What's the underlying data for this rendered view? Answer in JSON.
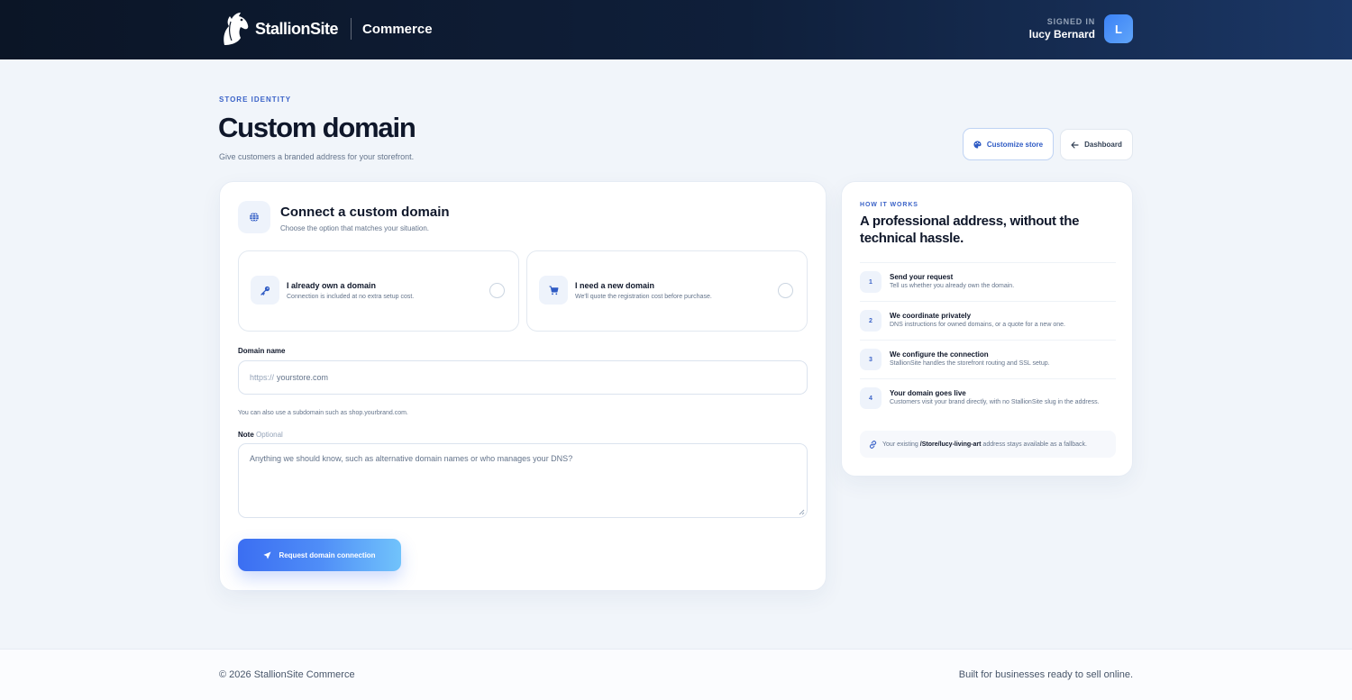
{
  "header": {
    "brand_name": "StallionSite",
    "product": "Commerce",
    "signed_in_label": "SIGNED IN",
    "user_name": "lucy Bernard",
    "avatar_initial": "L"
  },
  "page": {
    "eyebrow": "STORE IDENTITY",
    "title": "Custom domain",
    "subtitle": "Give customers a branded address for your storefront.",
    "customize_label": "Customize store",
    "dashboard_label": "Dashboard"
  },
  "form": {
    "title": "Connect a custom domain",
    "subtitle": "Choose the option that matches your situation.",
    "options": [
      {
        "title": "I already own a domain",
        "desc": "Connection is included at no extra setup cost.",
        "icon": "key-icon"
      },
      {
        "title": "I need a new domain",
        "desc": "We'll quote the registration cost before purchase.",
        "icon": "cart-icon"
      }
    ],
    "domain_label": "Domain name",
    "domain_prefix": "https://",
    "domain_placeholder": "yourstore.com",
    "domain_hint": "You can also use a subdomain such as shop.yourbrand.com.",
    "note_label": "Note",
    "note_optional": "Optional",
    "note_placeholder": "Anything we should know, such as alternative domain names or who manages your DNS?",
    "submit_label": "Request domain connection"
  },
  "how": {
    "eyebrow": "HOW IT WORKS",
    "title": "A professional address, without the technical hassle.",
    "steps": [
      {
        "num": "1",
        "title": "Send your request",
        "desc": "Tell us whether you already own the domain."
      },
      {
        "num": "2",
        "title": "We coordinate privately",
        "desc": "DNS instructions for owned domains, or a quote for a new one."
      },
      {
        "num": "3",
        "title": "We configure the connection",
        "desc": "StallionSite handles the storefront routing and SSL setup."
      },
      {
        "num": "4",
        "title": "Your domain goes live",
        "desc": "Customers visit your brand directly, with no StallionSite slug in the address."
      }
    ],
    "fallback_pre": "Your existing",
    "fallback_path": "/Store/lucy-living-art",
    "fallback_post": "address stays available as a fallback."
  },
  "footer": {
    "copyright": "© 2026 StallionSite Commerce",
    "tagline": "Built for businesses ready to sell online."
  },
  "colors": {
    "accent": "#3b6ef2",
    "header_bg": "#0b1526",
    "eyebrow": "#3b63c8"
  }
}
